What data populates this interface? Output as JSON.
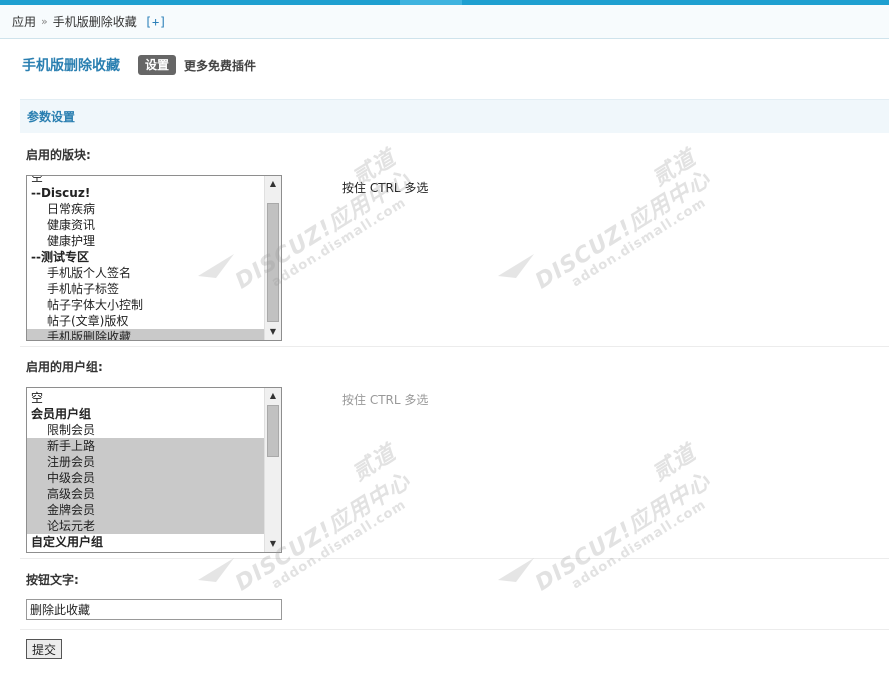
{
  "breadcrumb": {
    "root": "应用",
    "separator": "»",
    "current": "手机版删除收藏",
    "add": "[+]"
  },
  "header": {
    "plugin_title": "手机版删除收藏",
    "tab_settings": "设置",
    "tab_more": "更多免费插件"
  },
  "section": {
    "title": "参数设置"
  },
  "forums": {
    "label": "启用的版块:",
    "hint": "按住 CTRL 多选",
    "options": [
      {
        "label": "空",
        "kind": "plain",
        "selected": false
      },
      {
        "label": "--Discuz!",
        "kind": "group",
        "selected": false
      },
      {
        "label": "日常疾病",
        "kind": "indent",
        "selected": false
      },
      {
        "label": "健康资讯",
        "kind": "indent",
        "selected": false
      },
      {
        "label": "健康护理",
        "kind": "indent",
        "selected": false
      },
      {
        "label": "--测试专区",
        "kind": "group",
        "selected": false
      },
      {
        "label": "手机版个人签名",
        "kind": "indent",
        "selected": false
      },
      {
        "label": "手机帖子标签",
        "kind": "indent",
        "selected": false
      },
      {
        "label": "帖子字体大小控制",
        "kind": "indent",
        "selected": false
      },
      {
        "label": "帖子(文章)版权",
        "kind": "indent",
        "selected": false
      },
      {
        "label": "手机版删除收藏",
        "kind": "indent",
        "selected": true
      }
    ]
  },
  "groups": {
    "label": "启用的用户组:",
    "hint": "按住 CTRL 多选",
    "options": [
      {
        "label": "空",
        "kind": "plain",
        "selected": false
      },
      {
        "label": "会员用户组",
        "kind": "group",
        "selected": false
      },
      {
        "label": "限制会员",
        "kind": "indent",
        "selected": false
      },
      {
        "label": "新手上路",
        "kind": "indent",
        "selected": true
      },
      {
        "label": "注册会员",
        "kind": "indent",
        "selected": true
      },
      {
        "label": "中级会员",
        "kind": "indent",
        "selected": true
      },
      {
        "label": "高级会员",
        "kind": "indent",
        "selected": true
      },
      {
        "label": "金牌会员",
        "kind": "indent",
        "selected": true
      },
      {
        "label": "论坛元老",
        "kind": "indent",
        "selected": true
      },
      {
        "label": "自定义用户组",
        "kind": "group",
        "selected": false
      }
    ]
  },
  "button_text": {
    "label": "按钮文字:",
    "value": "删除此收藏"
  },
  "submit": {
    "label": "提交"
  },
  "watermark": {
    "brand": "DISCUZ!应用中心",
    "site": "addon.dismall.com",
    "mark": "贰道"
  },
  "colors": {
    "accent": "#1e9fd0",
    "title": "#2a7fb1",
    "selected_option": "#c9c9c9",
    "section_bg": "#f0f7fb"
  }
}
